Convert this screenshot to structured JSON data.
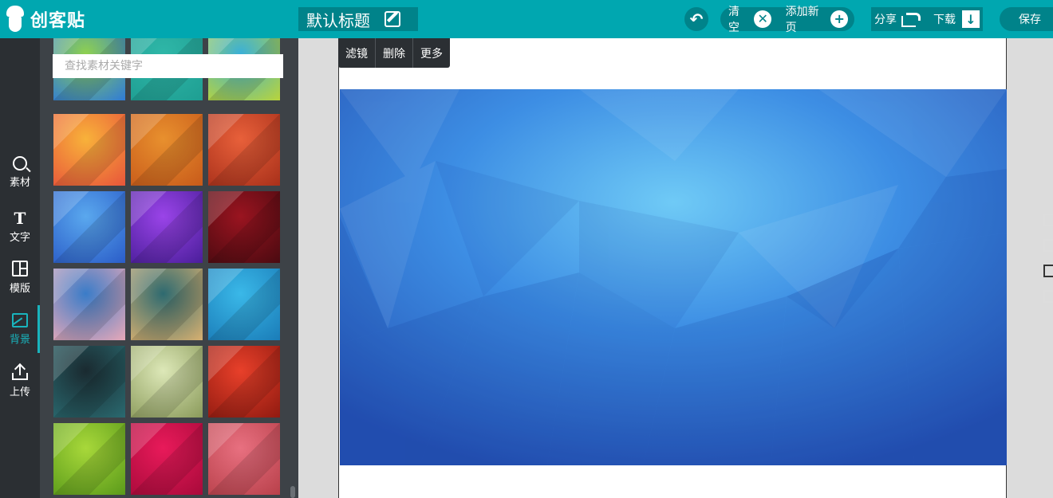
{
  "app": {
    "logo_text": "创客贴",
    "document_title": "默认标题"
  },
  "header": {
    "clear_label": "清空",
    "add_page_label": "添加新页",
    "share_label": "分享",
    "download_label": "下载",
    "save_label": "保存"
  },
  "nav": {
    "items": [
      {
        "label": "素材",
        "icon": "search-icon"
      },
      {
        "label": "文字",
        "icon": "text-icon"
      },
      {
        "label": "模版",
        "icon": "layout-icon"
      },
      {
        "label": "背景",
        "icon": "image-icon"
      },
      {
        "label": "上传",
        "icon": "upload-icon"
      }
    ],
    "active": "背景"
  },
  "panel": {
    "search_placeholder": "查找素材关键字"
  },
  "canvas_toolbar": {
    "filter_label": "滤镜",
    "delete_label": "删除",
    "more_label": "更多"
  },
  "colors": {
    "brand": "#00a7b0",
    "brand_dark": "#00838a",
    "nav_bg": "#2b2f33",
    "panel_bg": "#3d4247",
    "active": "#19b4bd"
  },
  "thumbnails": [
    {
      "name": "green-blue-bokeh",
      "c1": "#8fd14f",
      "c2": "#2f7bd8"
    },
    {
      "name": "teal-dots",
      "c1": "#2fb7a8",
      "c2": "#1e9e92"
    },
    {
      "name": "rainbow-polygon",
      "c1": "#3ab0d8",
      "c2": "#b9d43a"
    },
    {
      "name": "orange-bokeh",
      "c1": "#f8b23a",
      "c2": "#e8553a"
    },
    {
      "name": "orange-polygon",
      "c1": "#e8902e",
      "c2": "#c85a1a"
    },
    {
      "name": "red-polygon",
      "c1": "#e8603a",
      "c2": "#a8301a"
    },
    {
      "name": "blue-polygon",
      "c1": "#5aa8ee",
      "c2": "#2a5cc8"
    },
    {
      "name": "purple-polygon",
      "c1": "#9a44e8",
      "c2": "#4a1e9a"
    },
    {
      "name": "dark-red-polygon",
      "c1": "#9a1420",
      "c2": "#4a0a10"
    },
    {
      "name": "blue-pink-bokeh",
      "c1": "#3a7cc8",
      "c2": "#e8a8b8"
    },
    {
      "name": "teal-sand-gradient",
      "c1": "#2e6a70",
      "c2": "#d8b070"
    },
    {
      "name": "water-caustics",
      "c1": "#3ab8e8",
      "c2": "#1a7cb8"
    },
    {
      "name": "dark-teal-crystals",
      "c1": "#1a2a30",
      "c2": "#2a6a70"
    },
    {
      "name": "light-green-polygon",
      "c1": "#dde8b8",
      "c2": "#8a9a5a"
    },
    {
      "name": "red-orange-polygon",
      "c1": "#e8402a",
      "c2": "#901a10"
    },
    {
      "name": "lime-polygon",
      "c1": "#a8d83a",
      "c2": "#5a9a1a"
    },
    {
      "name": "magenta-polygon",
      "c1": "#e81a5a",
      "c2": "#a80a3a"
    },
    {
      "name": "pink-polygon",
      "c1": "#e87080",
      "c2": "#b8404a"
    }
  ]
}
